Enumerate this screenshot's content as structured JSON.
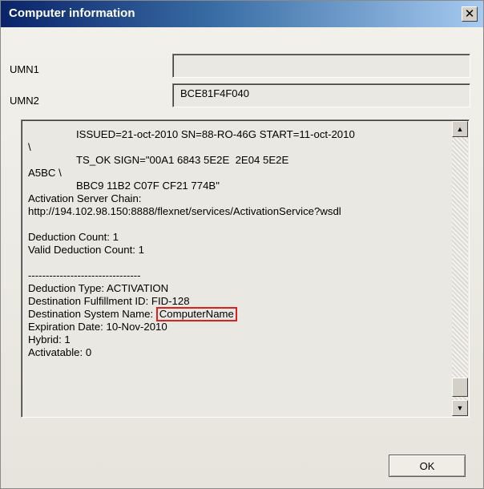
{
  "window": {
    "title": "Computer information",
    "close_glyph": "✕"
  },
  "fields": {
    "umn1_label": "UMN1",
    "umn1_value": "",
    "umn2_label": "UMN2",
    "umn2_value": "BCE81F4F040"
  },
  "details": {
    "lines": [
      "ISSUED=21-oct-2010 SN=88-RO-46G START=11-oct-2010",
      "\\",
      "TS_OK SIGN=\"00A1 6843 5E2E  2E04 5E2E",
      "A5BC \\",
      "BBC9 11B2 C07F CF21 774B\"",
      "Activation Server Chain:",
      "http://194.102.98.150:8888/flexnet/services/ActivationService?wsdl",
      "",
      "Deduction Count: 1",
      "Valid Deduction Count: 1",
      "",
      "--------------------------------",
      "Deduction Type: ACTIVATION",
      "Destination Fulfillment ID: FID-128",
      "Destination System Name: ",
      "ComputerName",
      "Expiration Date: 10-Nov-2010",
      "Hybrid: 1",
      "Activatable: 0"
    ]
  },
  "scrollbar": {
    "up_glyph": "▲",
    "down_glyph": "▼"
  },
  "buttons": {
    "ok_label": "OK"
  },
  "colors": {
    "highlight": "#e0201f",
    "title_bar_start": "#0a246a",
    "title_bar_end": "#a6caf0"
  }
}
